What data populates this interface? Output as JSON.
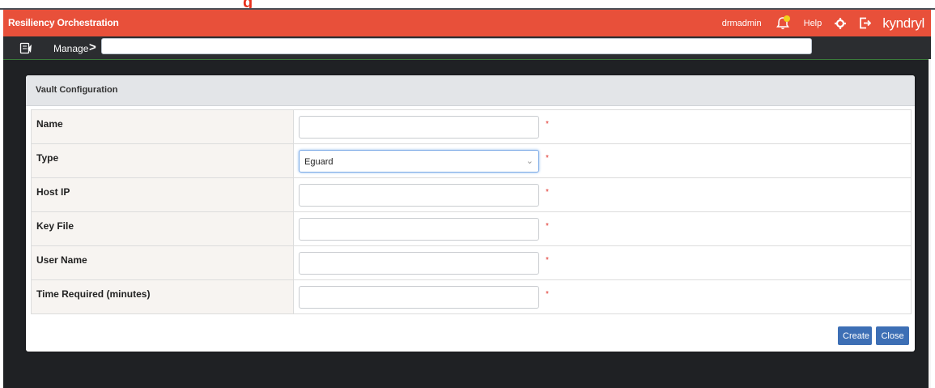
{
  "header": {
    "title": "Resiliency Orchestration",
    "user": "drmadmin",
    "help": "Help",
    "brand": "kyndryl",
    "accent_color": "#e8503a"
  },
  "subbar": {
    "manage_label": "Manage",
    "chevron": ">",
    "breadcrumb_value": ""
  },
  "panel": {
    "title": "Vault Configuration",
    "fields": [
      {
        "label": "Name",
        "value": "",
        "required": "*"
      },
      {
        "label": "Type",
        "value": "Eguard",
        "required": "*"
      },
      {
        "label": "Host IP",
        "value": "",
        "required": "*"
      },
      {
        "label": "Key File",
        "value": "",
        "required": "*"
      },
      {
        "label": "User Name",
        "value": "",
        "required": "*"
      },
      {
        "label": "Time Required (minutes)",
        "value": "",
        "required": "*"
      }
    ],
    "create_label": "Create",
    "close_label": "Close"
  },
  "icons": {
    "bell": "bell-icon",
    "gear": "gear-icon",
    "logout": "logout-icon",
    "manage": "manage-icon"
  }
}
